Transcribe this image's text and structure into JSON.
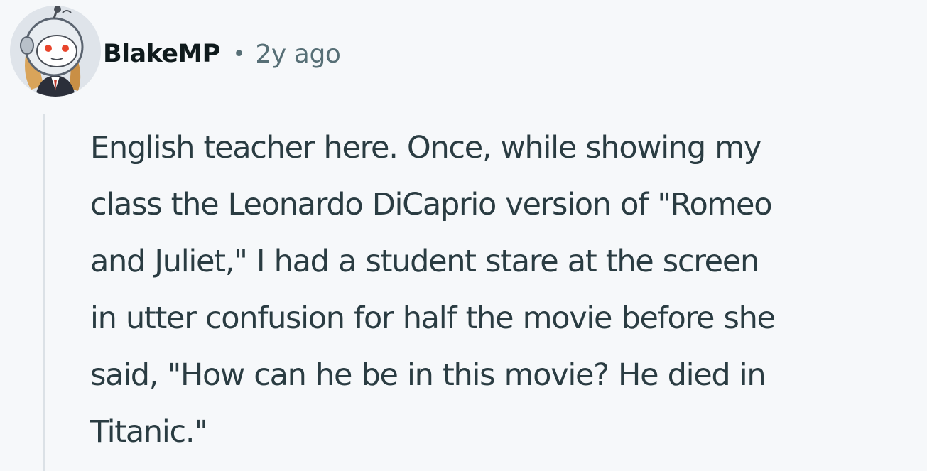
{
  "comment": {
    "author": "BlakeMP",
    "separator": "•",
    "age": "2y ago",
    "avatar_icon": "snoo-astronaut-avatar-icon",
    "body_lines": [
      "English teacher here. Once, while showing my",
      "class the Leonardo DiCaprio version of \"Romeo",
      "and Juliet,\" I had a student stare at the screen",
      "in utter confusion for half the movie before she",
      "said, \"How can he be in this movie? He died in",
      "Titanic.\""
    ]
  },
  "colors": {
    "background": "#f6f8fa",
    "author": "#0f1a1c",
    "meta": "#576f76",
    "body": "#2a3c42",
    "thread_line": "#dbe1e6"
  }
}
